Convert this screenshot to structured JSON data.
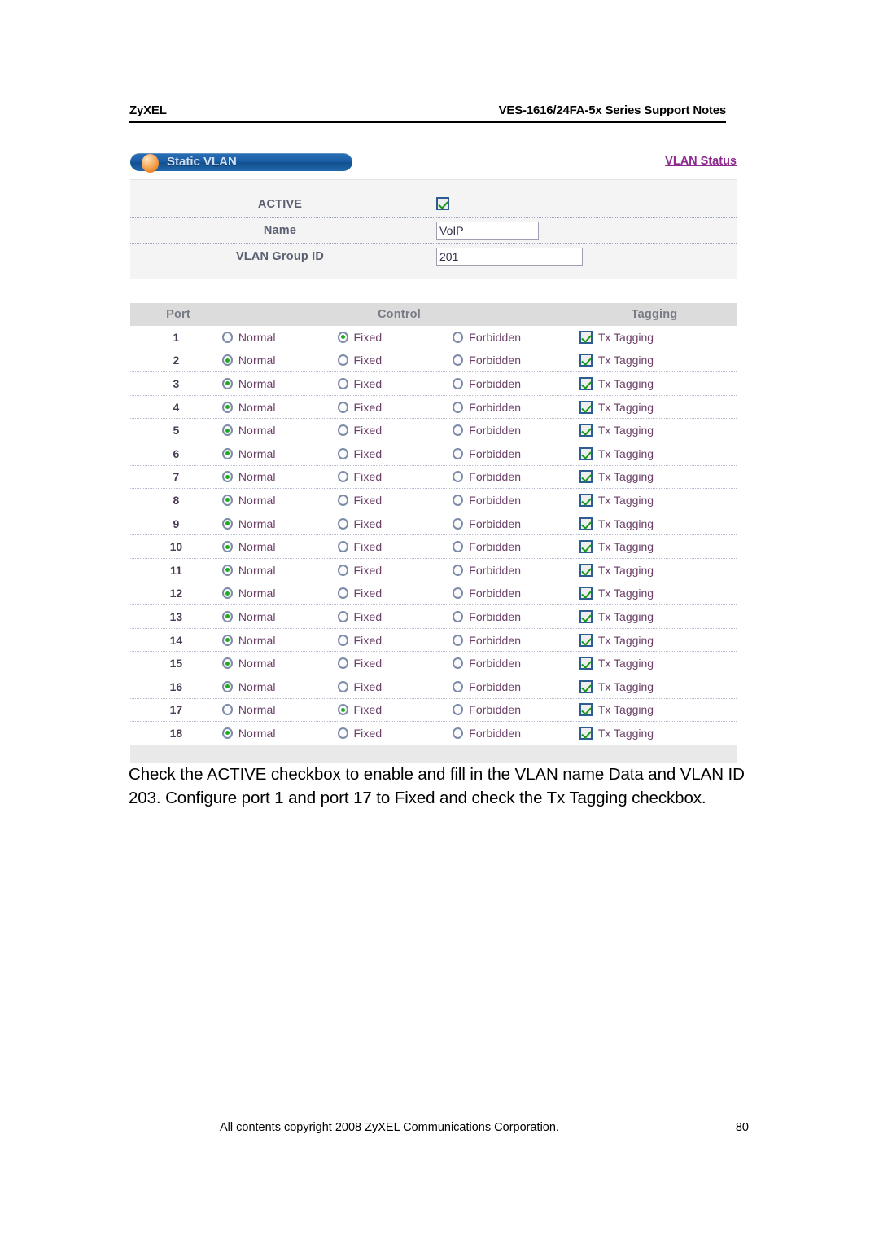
{
  "document_header": {
    "brand": "ZyXEL",
    "title": "VES-1616/24FA-5x Series Support Notes"
  },
  "panel": {
    "title": "Static VLAN",
    "status_link": "VLAN Status",
    "icon": "orange-sphere-icon"
  },
  "settings": {
    "active": {
      "label": "ACTIVE",
      "checked": true
    },
    "name": {
      "label": "Name",
      "value": "VoIP"
    },
    "vlan_group_id": {
      "label": "VLAN Group ID",
      "value": "201"
    }
  },
  "port_table": {
    "headers": {
      "port": "Port",
      "control": "Control",
      "tagging": "Tagging"
    },
    "control_options": [
      "Normal",
      "Fixed",
      "Forbidden"
    ],
    "tagging_label": "Tx Tagging",
    "rows": [
      {
        "port": "1",
        "control": "Fixed",
        "tx_tagging": true
      },
      {
        "port": "2",
        "control": "Normal",
        "tx_tagging": true
      },
      {
        "port": "3",
        "control": "Normal",
        "tx_tagging": true
      },
      {
        "port": "4",
        "control": "Normal",
        "tx_tagging": true
      },
      {
        "port": "5",
        "control": "Normal",
        "tx_tagging": true
      },
      {
        "port": "6",
        "control": "Normal",
        "tx_tagging": true
      },
      {
        "port": "7",
        "control": "Normal",
        "tx_tagging": true
      },
      {
        "port": "8",
        "control": "Normal",
        "tx_tagging": true
      },
      {
        "port": "9",
        "control": "Normal",
        "tx_tagging": true
      },
      {
        "port": "10",
        "control": "Normal",
        "tx_tagging": true
      },
      {
        "port": "11",
        "control": "Normal",
        "tx_tagging": true
      },
      {
        "port": "12",
        "control": "Normal",
        "tx_tagging": true
      },
      {
        "port": "13",
        "control": "Normal",
        "tx_tagging": true
      },
      {
        "port": "14",
        "control": "Normal",
        "tx_tagging": true
      },
      {
        "port": "15",
        "control": "Normal",
        "tx_tagging": true
      },
      {
        "port": "16",
        "control": "Normal",
        "tx_tagging": true
      },
      {
        "port": "17",
        "control": "Fixed",
        "tx_tagging": true
      },
      {
        "port": "18",
        "control": "Normal",
        "tx_tagging": true
      }
    ]
  },
  "caption": "Check the ACTIVE checkbox to enable and fill in the VLAN name Data and VLAN ID 203. Configure port 1 and port 17 to Fixed and check the Tx Tagging checkbox.",
  "footer": {
    "copyright": "All contents copyright 2008 ZyXEL Communications Corporation.",
    "page_number": "80"
  },
  "colors": {
    "title_bar_blue": "#1b5ea8",
    "link_purple": "#8e2a8e",
    "row_text": "#6b3f68",
    "header_gray": "#777b86",
    "check_green": "#169a16",
    "radio_green": "#1faa1f"
  }
}
